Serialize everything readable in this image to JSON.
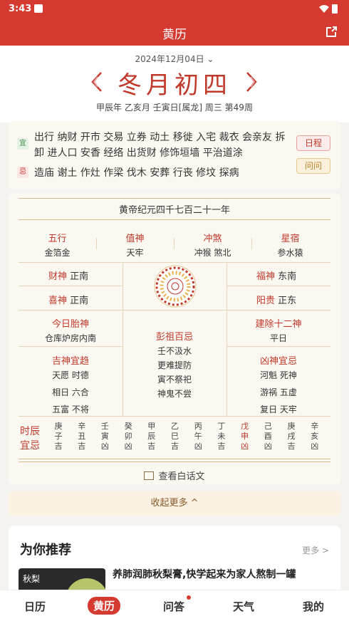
{
  "status": {
    "time": "3:43"
  },
  "appbar": {
    "title": "黄历"
  },
  "date": {
    "solar": "2024年12月04日",
    "caret": "⌄",
    "lunar": "冬月初四",
    "ganzhi": "甲辰年 乙亥月 壬寅日[属龙] 周三 第49周"
  },
  "yiji": {
    "yi_tag": "宜",
    "yi": "出行 纳财 开市 交易 立券 动土 移徙 入宅 裁衣 会亲友 拆卸 进人口 安香 经络 出货财 修饰垣墙 平治道涂",
    "ji_tag": "忌",
    "ji": "造庙 谢土 作灶 作梁 伐木 安葬 行丧 修坟 探病",
    "btn_schedule": "日程",
    "btn_ask": "问问"
  },
  "almanac": {
    "era": "黄帝纪元四千七百二十一年",
    "row1": [
      {
        "label": "五行",
        "value": "金箔金"
      },
      {
        "label": "值神",
        "value": "天牢"
      },
      {
        "label": "冲煞",
        "value": "冲猴 煞北"
      },
      {
        "label": "星宿",
        "value": "参水猿"
      }
    ],
    "caishen": {
      "label": "财神",
      "value": "正南"
    },
    "xishen": {
      "label": "喜神",
      "value": "正南"
    },
    "fushen": {
      "label": "福神",
      "value": "东南"
    },
    "yanggui": {
      "label": "阳贵",
      "value": "正东"
    },
    "taishen": {
      "label": "今日胎神",
      "value": "仓库炉房内南"
    },
    "jianchu": {
      "label": "建除十二神",
      "value": "平日"
    },
    "pengzu": {
      "label": "彭祖百忌",
      "lines": [
        "壬不汲水",
        "更难提防",
        "寅不祭祀",
        "神鬼不尝"
      ]
    },
    "jishen": {
      "label": "吉神宜趋",
      "lines": [
        "天愿 时德",
        "相日 六合",
        "五富 不将"
      ]
    },
    "xiongshen": {
      "label": "凶神宜忌",
      "lines": [
        "河魁 死神",
        "游祸 五虚",
        "复日 天牢"
      ]
    },
    "hours_label": [
      "时辰",
      "宜忌"
    ],
    "hours": [
      {
        "gan": "庚",
        "zhi": "子",
        "luck": "吉"
      },
      {
        "gan": "辛",
        "zhi": "丑",
        "luck": "吉"
      },
      {
        "gan": "壬",
        "zhi": "寅",
        "luck": "凶"
      },
      {
        "gan": "癸",
        "zhi": "卯",
        "luck": "凶"
      },
      {
        "gan": "甲",
        "zhi": "辰",
        "luck": "吉"
      },
      {
        "gan": "乙",
        "zhi": "巳",
        "luck": "吉"
      },
      {
        "gan": "丙",
        "zhi": "午",
        "luck": "凶"
      },
      {
        "gan": "丁",
        "zhi": "未",
        "luck": "吉"
      },
      {
        "gan": "戊",
        "zhi": "申",
        "luck": "凶"
      },
      {
        "gan": "己",
        "zhi": "酉",
        "luck": "凶"
      },
      {
        "gan": "庚",
        "zhi": "戌",
        "luck": "吉"
      },
      {
        "gan": "辛",
        "zhi": "亥",
        "luck": "凶"
      }
    ],
    "highlight_hour": "申",
    "view_text": "查看白话文"
  },
  "collapse": "收起更多 ^",
  "recommend": {
    "heading": "为你推荐",
    "more": "更多 >",
    "thumb_text": "秋梨",
    "article_title": "养肺润肺秋梨膏,快学起来为家人熬制一罐"
  },
  "tabs": [
    "日历",
    "黄历",
    "问答",
    "天气",
    "我的"
  ],
  "active_tab": "黄历",
  "colors": {
    "brand": "#d43a30",
    "gold": "#d8b98a"
  }
}
